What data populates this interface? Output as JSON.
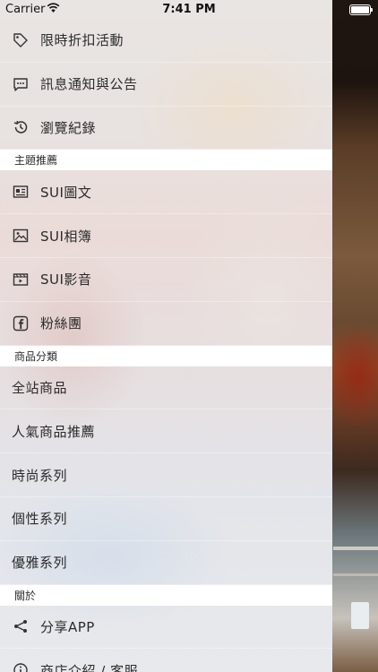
{
  "status_bar": {
    "carrier": "Carrier",
    "time": "7:41 PM"
  },
  "menu": {
    "top_items": [
      {
        "label": "限時折扣活動",
        "icon": "tag-icon"
      },
      {
        "label": "訊息通知與公告",
        "icon": "message-icon"
      },
      {
        "label": "瀏覽紀錄",
        "icon": "history-icon"
      }
    ],
    "sections": [
      {
        "title": "主題推薦",
        "items": [
          {
            "label": "SUI圖文",
            "icon": "article-icon"
          },
          {
            "label": "SUI相簿",
            "icon": "photo-icon"
          },
          {
            "label": "SUI影音",
            "icon": "video-icon"
          },
          {
            "label": "粉絲團",
            "icon": "facebook-icon"
          }
        ]
      },
      {
        "title": "商品分類",
        "items": [
          {
            "label": "全站商品"
          },
          {
            "label": "人氣商品推薦"
          },
          {
            "label": "時尚系列"
          },
          {
            "label": "個性系列"
          },
          {
            "label": "優雅系列"
          }
        ]
      },
      {
        "title": "關於",
        "items": [
          {
            "label": "分享APP",
            "icon": "share-icon"
          },
          {
            "label": "商店介紹 / 客服",
            "icon": "info-icon"
          }
        ]
      }
    ]
  }
}
